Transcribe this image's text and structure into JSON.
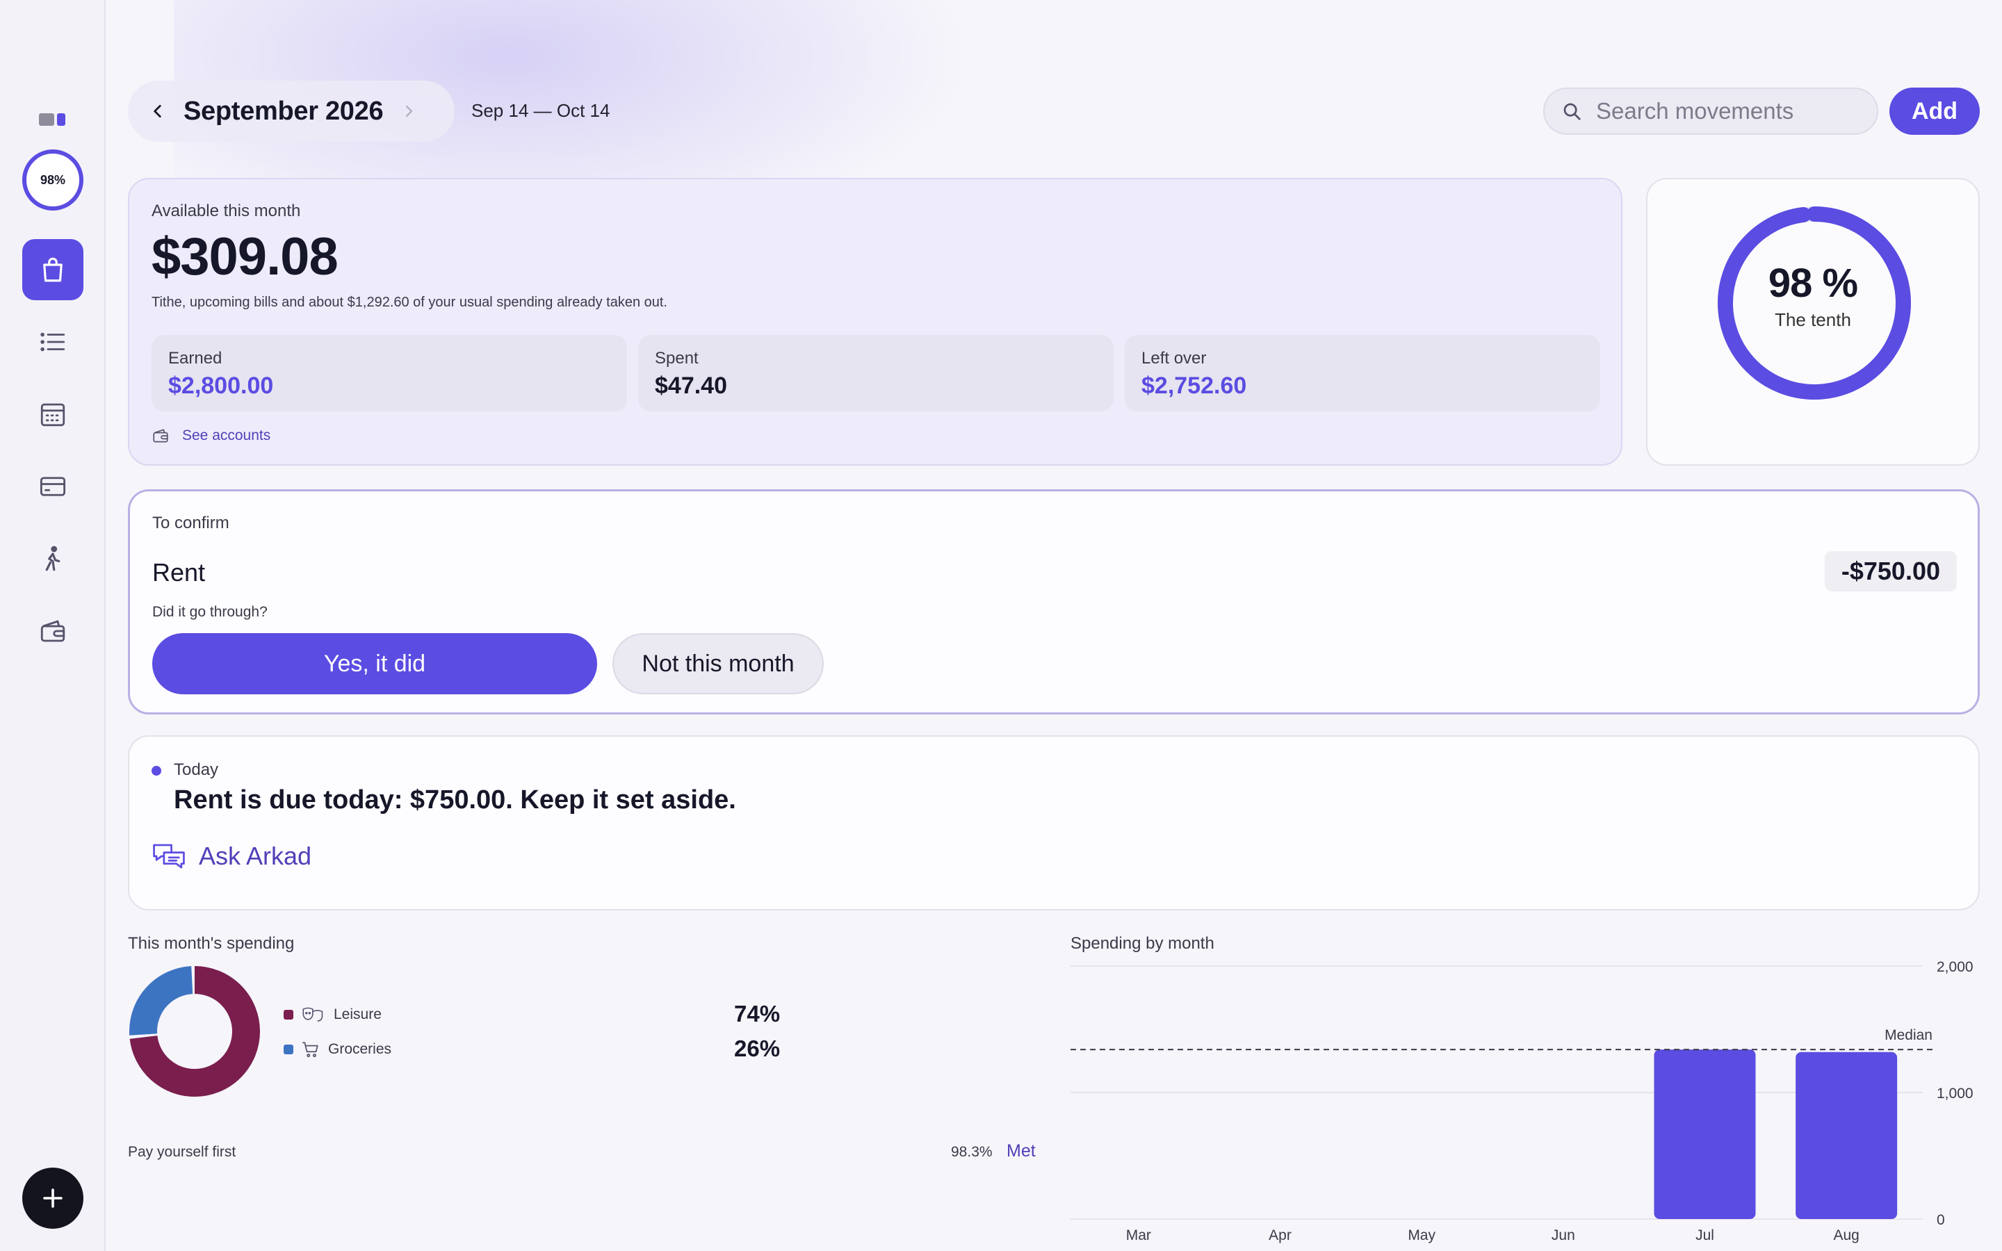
{
  "header": {
    "month_title": "September 2026",
    "range": "Sep 14 — Oct 14",
    "search_placeholder": "Search movements",
    "add_label": "Add"
  },
  "sidebar": {
    "progress_badge": "98%",
    "items": [
      {
        "icon": "shopping-bag-icon",
        "active": true
      },
      {
        "icon": "list-icon"
      },
      {
        "icon": "calendar-icon"
      },
      {
        "icon": "credit-card-icon"
      },
      {
        "icon": "walking-person-icon"
      },
      {
        "icon": "wallet-icon"
      }
    ],
    "add_icon": "plus-icon"
  },
  "available": {
    "label": "Available this month",
    "amount": "$309.08",
    "note": "Tithe, upcoming bills and about $1,292.60 of your usual spending already taken out.",
    "stats": [
      {
        "label": "Earned",
        "value": "$2,800.00"
      },
      {
        "label": "Spent",
        "value": "$47.40"
      },
      {
        "label": "Left over",
        "value": "$2,752.60"
      }
    ],
    "see_accounts": "See accounts"
  },
  "ring": {
    "percent_text": "98 %",
    "percent": 0.98,
    "subtitle": "The tenth"
  },
  "confirm": {
    "label": "To confirm",
    "title": "Rent",
    "amount": "-$750.00",
    "question": "Did it go through?",
    "yes_label": "Yes, it did",
    "no_label": "Not this month"
  },
  "today": {
    "label": "Today",
    "message": "Rent is due today: $750.00. Keep it set aside.",
    "ask_label": "Ask Arkad"
  },
  "monthly_spending": {
    "title": "This month's spending",
    "categories": [
      {
        "name": "Leisure",
        "percent_text": "74%",
        "share": 0.74,
        "color": "#7a1e4e",
        "icon": "theater-masks-icon"
      },
      {
        "name": "Groceries",
        "percent_text": "26%",
        "share": 0.26,
        "color": "#3d74c2",
        "icon": "shopping-cart-icon"
      }
    ],
    "pay_yourself_label": "Pay yourself first",
    "pay_yourself_value": "98.3%",
    "pay_yourself_status": "Met"
  },
  "colors": {
    "accent": "#5b4ce2",
    "leisure": "#7a1e4e",
    "groceries": "#3d74c2"
  },
  "chart_data": {
    "type": "bar",
    "title": "Spending by month",
    "categories": [
      "Mar",
      "Apr",
      "May",
      "Jun",
      "Jul",
      "Aug"
    ],
    "values": [
      0,
      0,
      0,
      0,
      1340,
      1320
    ],
    "ylim": [
      0,
      2000
    ],
    "yticks": [
      "0",
      "1,000",
      "2,000"
    ],
    "reference_line": {
      "label": "Median",
      "value": 1340
    },
    "grid": true,
    "color": "#5b4ce2"
  }
}
